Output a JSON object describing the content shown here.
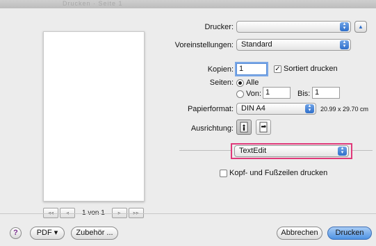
{
  "window": {
    "ghost_title": "Drucken · Seite 1"
  },
  "preview": {
    "page_text": "1 von 1",
    "first_label": "◂◂",
    "prev_label": "◂",
    "next_label": "▸",
    "last_label": "▸▸"
  },
  "printer": {
    "label": "Drucker:",
    "value": ""
  },
  "presets": {
    "label": "Voreinstellungen:",
    "value": "Standard"
  },
  "copies": {
    "label": "Kopien:",
    "value": "1",
    "collate_label": "Sortiert drucken",
    "collate_checked": true
  },
  "pages": {
    "label": "Seiten:",
    "all_label": "Alle",
    "from_label": "Von:",
    "from_value": "1",
    "to_label": "Bis:",
    "to_value": "1"
  },
  "paper": {
    "label": "Papierformat:",
    "value": "DIN A4",
    "size_text": "20.99 x 29.70 cm"
  },
  "orientation": {
    "label": "Ausrichtung:"
  },
  "app_section": {
    "value": "TextEdit"
  },
  "header_footer": {
    "label": "Kopf- und Fußzeilen drucken",
    "checked": false
  },
  "footer": {
    "help": "?",
    "pdf_label": "PDF ▾",
    "accessories_label": "Zubehör ...",
    "cancel_label": "Abbrechen",
    "print_label": "Drucken"
  },
  "colors": {
    "highlight": "#e0397a",
    "accent": "#4d92e3"
  }
}
